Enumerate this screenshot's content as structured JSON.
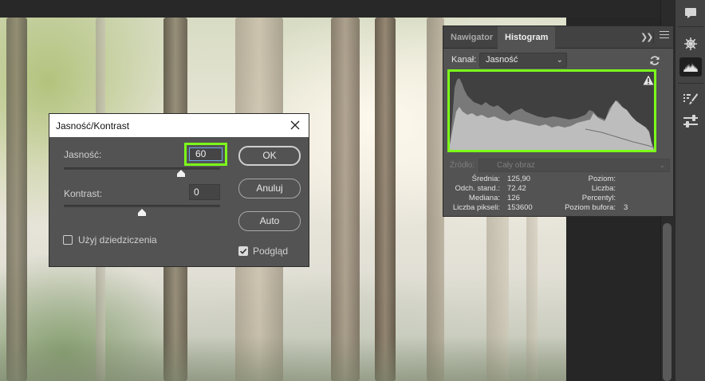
{
  "dialog": {
    "title": "Jasność/Kontrast",
    "brightness_label": "Jasność:",
    "brightness_value": "60",
    "brightness_level": 0.75,
    "contrast_label": "Kontrast:",
    "contrast_value": "0",
    "contrast_level": 0.5,
    "legacy_label": "Użyj dziedziczenia",
    "legacy_checked": false,
    "ok_label": "OK",
    "cancel_label": "Anuluj",
    "auto_label": "Auto",
    "preview_label": "Podgląd",
    "preview_checked": true
  },
  "histogram": {
    "tabs": [
      {
        "label": "Nawigator",
        "active": false
      },
      {
        "label": "Histogram",
        "active": true
      }
    ],
    "collapse_icon": "double-chevron-right-icon",
    "menu_icon": "hamburger-menu-icon",
    "channel_label": "Kanał:",
    "channel_value": "Jasność",
    "refresh_icon": "refresh-icon",
    "warning_icon": "warning-triangle-icon",
    "source_label": "Źródło:",
    "source_value": "Cały obraz",
    "stats_left": [
      {
        "label": "Średnia:",
        "value": "125,90"
      },
      {
        "label": "Odch. stand.:",
        "value": "72.42"
      },
      {
        "label": "Mediana:",
        "value": "126"
      },
      {
        "label": "Liczba pikseli:",
        "value": "153600"
      }
    ],
    "stats_right": [
      {
        "label": "Poziom:",
        "value": ""
      },
      {
        "label": "Liczba:",
        "value": ""
      },
      {
        "label": "Percentyl:",
        "value": ""
      },
      {
        "label": "Poziom bufora:",
        "value": "3"
      }
    ]
  },
  "right_strip": {
    "icons": [
      "comment-icon",
      "ship-wheel-icon",
      "histogram-icon",
      "brush-settings-icon",
      "adjustments-sliders-icon"
    ],
    "active_icon": "histogram-icon"
  },
  "colors": {
    "highlight": "#7cfc1a",
    "panel_bg": "#535353",
    "app_bg": "#282828"
  }
}
